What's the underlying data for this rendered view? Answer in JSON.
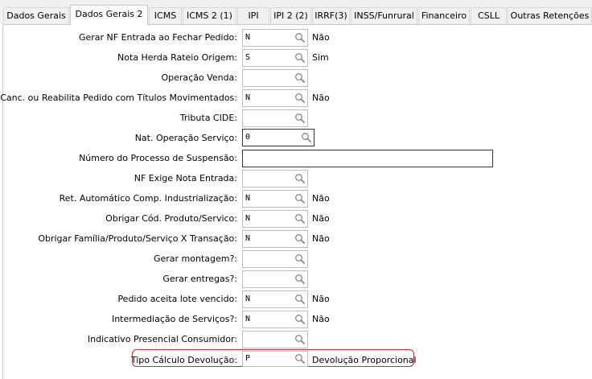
{
  "tabs": [
    {
      "label": "Dados Gerais",
      "active": false
    },
    {
      "label": "Dados Gerais 2",
      "active": true
    },
    {
      "label": "ICMS",
      "active": false
    },
    {
      "label": "ICMS 2 (1)",
      "active": false
    },
    {
      "label": "IPI",
      "active": false
    },
    {
      "label": "IPI 2 (2)",
      "active": false
    },
    {
      "label": "IRRF(3)",
      "active": false
    },
    {
      "label": "INSS/Funrural",
      "active": false
    },
    {
      "label": "Financeiro",
      "active": false
    },
    {
      "label": "CSLL",
      "active": false
    },
    {
      "label": "Outras Retenções",
      "active": false
    }
  ],
  "fields": [
    {
      "label": "Gerar NF Entrada ao Fechar Pedido:",
      "value": "N",
      "description": "Não"
    },
    {
      "label": "Nota Herda Rateio Origem:",
      "value": "S",
      "description": "Sim"
    },
    {
      "label": "Operação Venda:",
      "value": "",
      "description": ""
    },
    {
      "label": "Canc. ou Reabilita Pedido com Títulos Movimentados:",
      "value": "N",
      "description": "Não"
    },
    {
      "label": "Tributa CIDE:",
      "value": "",
      "description": ""
    },
    {
      "label": "Nat. Operação Serviço:",
      "value": "0",
      "description": ""
    },
    {
      "label": "Número do Processo de Suspensão:",
      "value": "",
      "description": ""
    },
    {
      "label": "NF Exige Nota Entrada:",
      "value": "",
      "description": ""
    },
    {
      "label": "Ret. Automático Comp. Industrialização:",
      "value": "N",
      "description": "Não"
    },
    {
      "label": "Obrigar Cód. Produto/Servico:",
      "value": "N",
      "description": "Não"
    },
    {
      "label": "Obrigar Família/Produto/Serviço X Transação:",
      "value": "N",
      "description": "Não"
    },
    {
      "label": "Gerar montagem?:",
      "value": "",
      "description": ""
    },
    {
      "label": "Gerar entregas?:",
      "value": "",
      "description": ""
    },
    {
      "label": "Pedido aceita lote vencido:",
      "value": "N",
      "description": "Não"
    },
    {
      "label": "Intermediação de Serviços?:",
      "value": "N",
      "description": "Não"
    },
    {
      "label": "Indicativo Presencial Consumidor:",
      "value": "",
      "description": ""
    },
    {
      "label": "Tipo Cálculo Devolução:",
      "value": "P",
      "description": "Devolução Proporcional"
    }
  ],
  "colors": {
    "highlight": "#e0252b",
    "field_border": "#bdbdbd",
    "tab_bg": "#f0f0f0"
  },
  "icons": {
    "lookup": "magnifier-icon"
  }
}
